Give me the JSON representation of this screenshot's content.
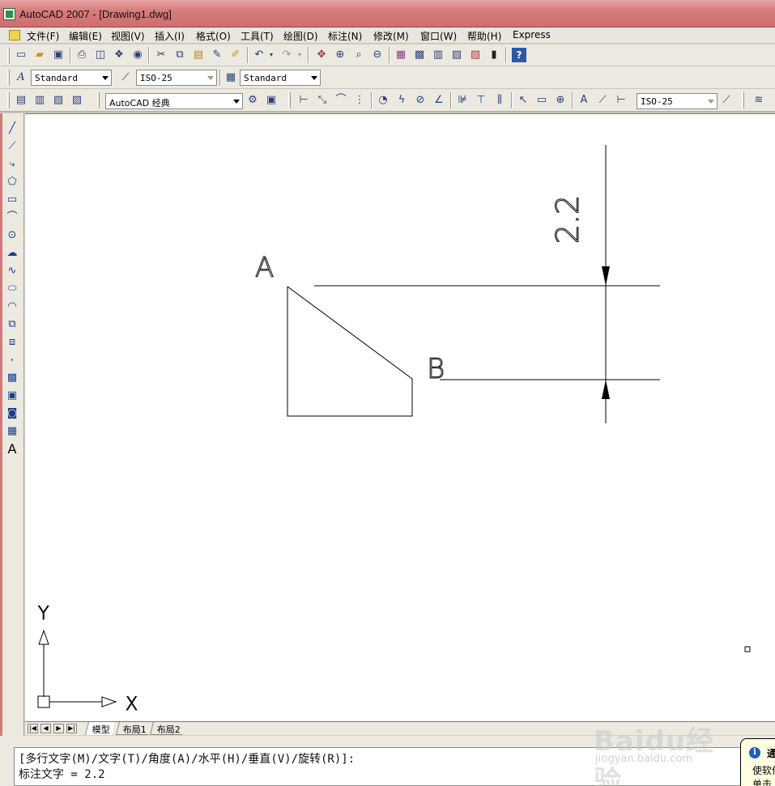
{
  "window": {
    "title": "AutoCAD 2007 - [Drawing1.dwg]"
  },
  "menu": [
    "文件(F)",
    "编辑(E)",
    "视图(V)",
    "插入(I)",
    "格式(O)",
    "工具(T)",
    "绘图(D)",
    "标注(N)",
    "修改(M)",
    "窗口(W)",
    "帮助(H)",
    "Express"
  ],
  "styles_toolbar": {
    "text_style": "Standard",
    "dim_style": "ISO-25",
    "table_style": "Standard"
  },
  "workspace_toolbar": {
    "workspace": "AutoCAD 经典",
    "dim_style": "ISO-25"
  },
  "drawing": {
    "label_a": "A",
    "label_b": "B",
    "dimension_text": "2.2",
    "ucs_x": "X",
    "ucs_y": "Y"
  },
  "layout_tabs": [
    "模型",
    "布局1",
    "布局2"
  ],
  "command": {
    "line1": "[多行文字(M)/文字(T)/角度(A)/水平(H)/垂直(V)/旋转(R)]:",
    "line2": "标注文字 = 2.2"
  },
  "balloon": {
    "title": "通",
    "line1": "使软件",
    "line2": "单击"
  },
  "watermark": {
    "brand": "Baidu经验",
    "url": "jingyan.baidu.com"
  },
  "icons": {
    "standard_toolbar": [
      "new-icon",
      "open-icon",
      "save-icon",
      "plot-icon",
      "plot-preview-icon",
      "publish-icon",
      "3d-dwf-icon",
      "cut-icon",
      "copy-icon",
      "paste-icon",
      "match-properties-icon",
      "block-editor-icon",
      "undo-icon",
      "redo-icon",
      "pan-icon",
      "zoom-realtime-icon",
      "zoom-window-icon",
      "zoom-previous-icon",
      "properties-icon",
      "design-center-icon",
      "tool-palettes-icon",
      "sheet-set-icon",
      "markup-icon",
      "quickcalc-icon",
      "help-icon"
    ],
    "draw_toolbar": [
      "line-icon",
      "construction-line-icon",
      "polyline-icon",
      "polygon-icon",
      "rectangle-icon",
      "arc-icon",
      "circle-icon",
      "revision-cloud-icon",
      "spline-icon",
      "ellipse-icon",
      "ellipse-arc-icon",
      "insert-block-icon",
      "make-block-icon",
      "point-icon",
      "hatch-icon",
      "gradient-icon",
      "region-icon",
      "table-icon",
      "multiline-text-icon"
    ]
  }
}
